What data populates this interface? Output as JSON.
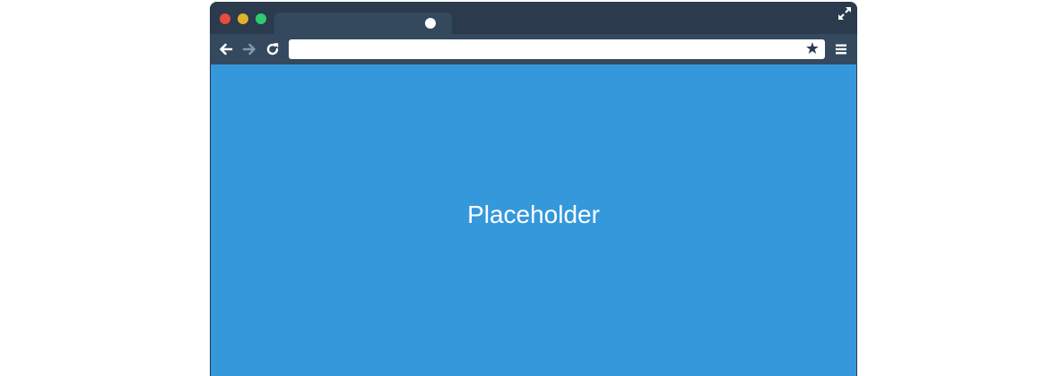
{
  "window": {
    "traffic_lights": [
      "#e74c3c",
      "#e0b02a",
      "#2ecc71"
    ],
    "fullscreen_icon": "expand-arrows-icon"
  },
  "tab": {
    "title": "",
    "close_icon": "tab-close-dot-icon"
  },
  "toolbar": {
    "back_icon": "arrow-left-icon",
    "forward_icon": "arrow-right-icon",
    "reload_icon": "reload-icon",
    "url": "",
    "bookmark_glyph": "★",
    "menu_icon": "hamburger-menu-icon"
  },
  "content": {
    "text": "Placeholder",
    "background": "#3498db"
  }
}
